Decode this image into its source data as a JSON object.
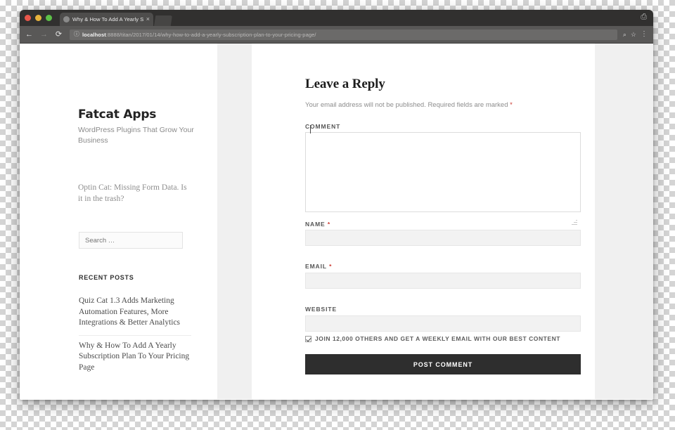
{
  "browser": {
    "tab": {
      "title": "Why & How To Add A Yearly S",
      "close_label": "×",
      "favicon_name": "globe-icon"
    },
    "print_icon": "⎙",
    "nav": {
      "back": "←",
      "forward": "→",
      "reload": "⟳"
    },
    "omnibox": {
      "info_icon": "ⓘ",
      "host": "localhost",
      "path": ":8888/titan/2017/01/14/why-how-to-add-a-yearly-subscription-plan-to-your-pricing-page/"
    },
    "actions": {
      "zoom_icon": "⌕",
      "bookmark_icon": "☆",
      "menu_icon": "⋮"
    }
  },
  "sidebar": {
    "site_title": "Fatcat Apps",
    "tagline": "WordPress Plugins That Grow Your Business",
    "post_link": "Optin Cat: Missing Form Data. Is it in the trash?",
    "search": {
      "placeholder": "Search …",
      "value": ""
    },
    "recent_posts": {
      "heading": "RECENT POSTS",
      "items": [
        "Quiz Cat 1.3 Adds Marketing Automation Features, More Integrations & Better Analytics",
        "Why & How To Add A Yearly Subscription Plan To Your Pricing Page"
      ]
    }
  },
  "comment_form": {
    "title": "Leave a Reply",
    "notice": "Your email address will not be published. Required fields are marked",
    "required_mark": "*",
    "fields": {
      "comment": {
        "label": "COMMENT",
        "value": ""
      },
      "name": {
        "label": "NAME",
        "required": "*",
        "value": ""
      },
      "email": {
        "label": "EMAIL",
        "required": "*",
        "value": ""
      },
      "website": {
        "label": "WEBSITE",
        "value": ""
      }
    },
    "subscribe": {
      "label": "JOIN 12,000 OTHERS AND GET A WEEKLY EMAIL WITH OUR BEST CONTENT",
      "checked": true
    },
    "submit_label": "POST COMMENT"
  },
  "colors": {
    "button_dark": "#2e2e2e",
    "required_red": "#cc3b33",
    "page_gutter": "#f0f0f0"
  }
}
